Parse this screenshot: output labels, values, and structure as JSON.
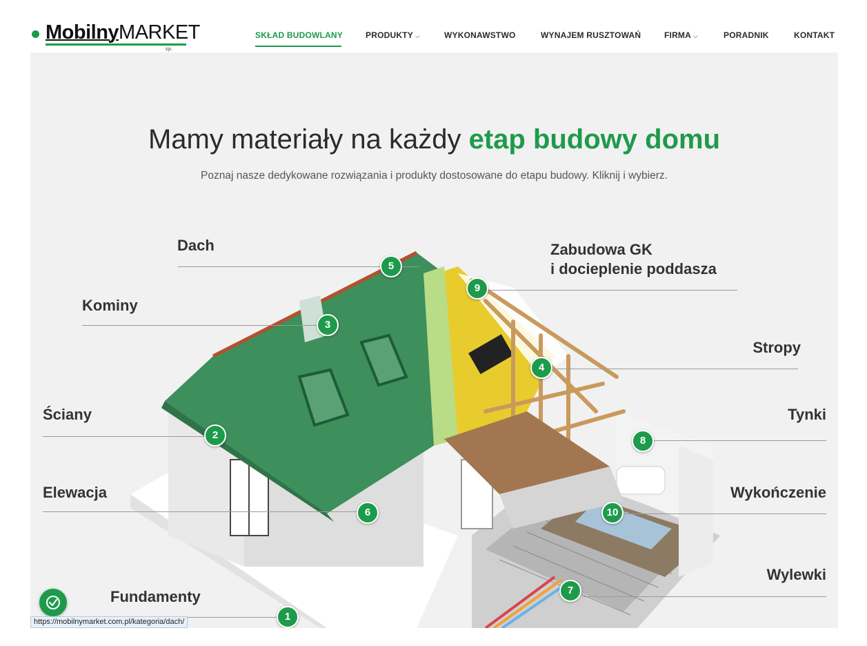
{
  "logo": {
    "bold": "Mobilny",
    "regular": "MARKET",
    "sub": "sp. z o.o."
  },
  "nav": [
    {
      "label": "SKŁAD BUDOWLANY",
      "active": true,
      "dropdown": false
    },
    {
      "label": "PRODUKTY",
      "active": false,
      "dropdown": true
    },
    {
      "label": "WYKONAWSTWO",
      "active": false,
      "dropdown": false
    },
    {
      "label": "WYNAJEM RUSZTOWAŃ",
      "active": false,
      "dropdown": false
    },
    {
      "label": "FIRMA",
      "active": false,
      "dropdown": true
    },
    {
      "label": "PORADNIK",
      "active": false,
      "dropdown": false
    },
    {
      "label": "KONTAKT",
      "active": false,
      "dropdown": false
    }
  ],
  "hero": {
    "title_plain": "Mamy materiały na każdy ",
    "title_accent": "etap budowy domu",
    "subtitle": "Poznaj nasze dedykowane rozwiązania i produkty dostosowane do etapu budowy. Kliknij i wybierz."
  },
  "stages": [
    {
      "number": "1",
      "label": "Fundamenty"
    },
    {
      "number": "2",
      "label": "Ściany"
    },
    {
      "number": "3",
      "label": "Kominy"
    },
    {
      "number": "4",
      "label": "Stropy"
    },
    {
      "number": "5",
      "label": "Dach"
    },
    {
      "number": "6",
      "label": "Elewacja"
    },
    {
      "number": "7",
      "label": "Wylewki"
    },
    {
      "number": "8",
      "label": "Tynki"
    },
    {
      "number": "9",
      "label": "Zabudowa GK\ni docieplenie poddasza"
    },
    {
      "number": "10",
      "label": "Wykończenie"
    }
  ],
  "status_url": "https://mobilnymarket.com.pl/kategoria/dach/",
  "icons": {
    "badge": "accessibility-check-icon",
    "chevron": "chevron-down-icon"
  },
  "colors": {
    "accent": "#1e9a4b",
    "roof": "#3d8f5c",
    "background": "#f1f1f1"
  }
}
